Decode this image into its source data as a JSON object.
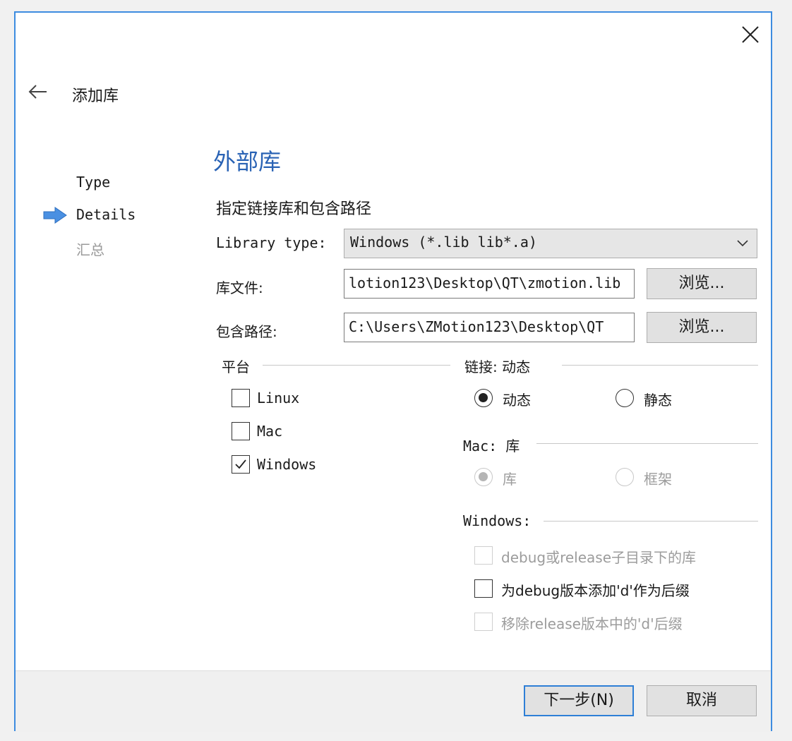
{
  "wizard": {
    "title": "添加库",
    "steps": [
      {
        "label": "Type",
        "state": "done"
      },
      {
        "label": "Details",
        "state": "current"
      },
      {
        "label": "汇总",
        "state": "todo"
      }
    ]
  },
  "page": {
    "title": "外部库",
    "subtitle": "指定链接库和包含路径"
  },
  "form": {
    "library_type_label": "Library type:",
    "library_type_value": "Windows (*.lib lib*.a)",
    "library_file_label": "库文件:",
    "library_file_value": "lotion123\\Desktop\\QT\\zmotion.lib",
    "include_path_label": "包含路径:",
    "include_path_value": "C:\\Users\\ZMotion123\\Desktop\\QT",
    "browse_label": "浏览..."
  },
  "platform": {
    "title": "平台",
    "options": [
      {
        "label": "Linux",
        "checked": false
      },
      {
        "label": "Mac",
        "checked": false
      },
      {
        "label": "Windows",
        "checked": true
      }
    ]
  },
  "linkage": {
    "title": "链接: 动态",
    "options": [
      {
        "label": "动态",
        "selected": true
      },
      {
        "label": "静态",
        "selected": false
      }
    ]
  },
  "mac": {
    "title": "Mac: 库",
    "options": [
      {
        "label": "库",
        "selected": true,
        "disabled": true
      },
      {
        "label": "框架",
        "selected": false,
        "disabled": true
      }
    ]
  },
  "windows": {
    "title": "Windows:",
    "options": [
      {
        "label": "debug或release子目录下的库",
        "checked": false,
        "disabled": true
      },
      {
        "label": "为debug版本添加'd'作为后缀",
        "checked": false,
        "disabled": false
      },
      {
        "label": "移除release版本中的'd'后缀",
        "checked": false,
        "disabled": true
      }
    ]
  },
  "footer": {
    "next_label": "下一步(N)",
    "cancel_label": "取消"
  },
  "colors": {
    "accent": "#3d8ce0",
    "title_blue": "#2a63b5",
    "step_arrow": "#4a90e2"
  },
  "icons": [
    "close-icon",
    "back-arrow-icon",
    "current-step-arrow-icon",
    "chevron-down-icon",
    "checkmark-icon"
  ]
}
